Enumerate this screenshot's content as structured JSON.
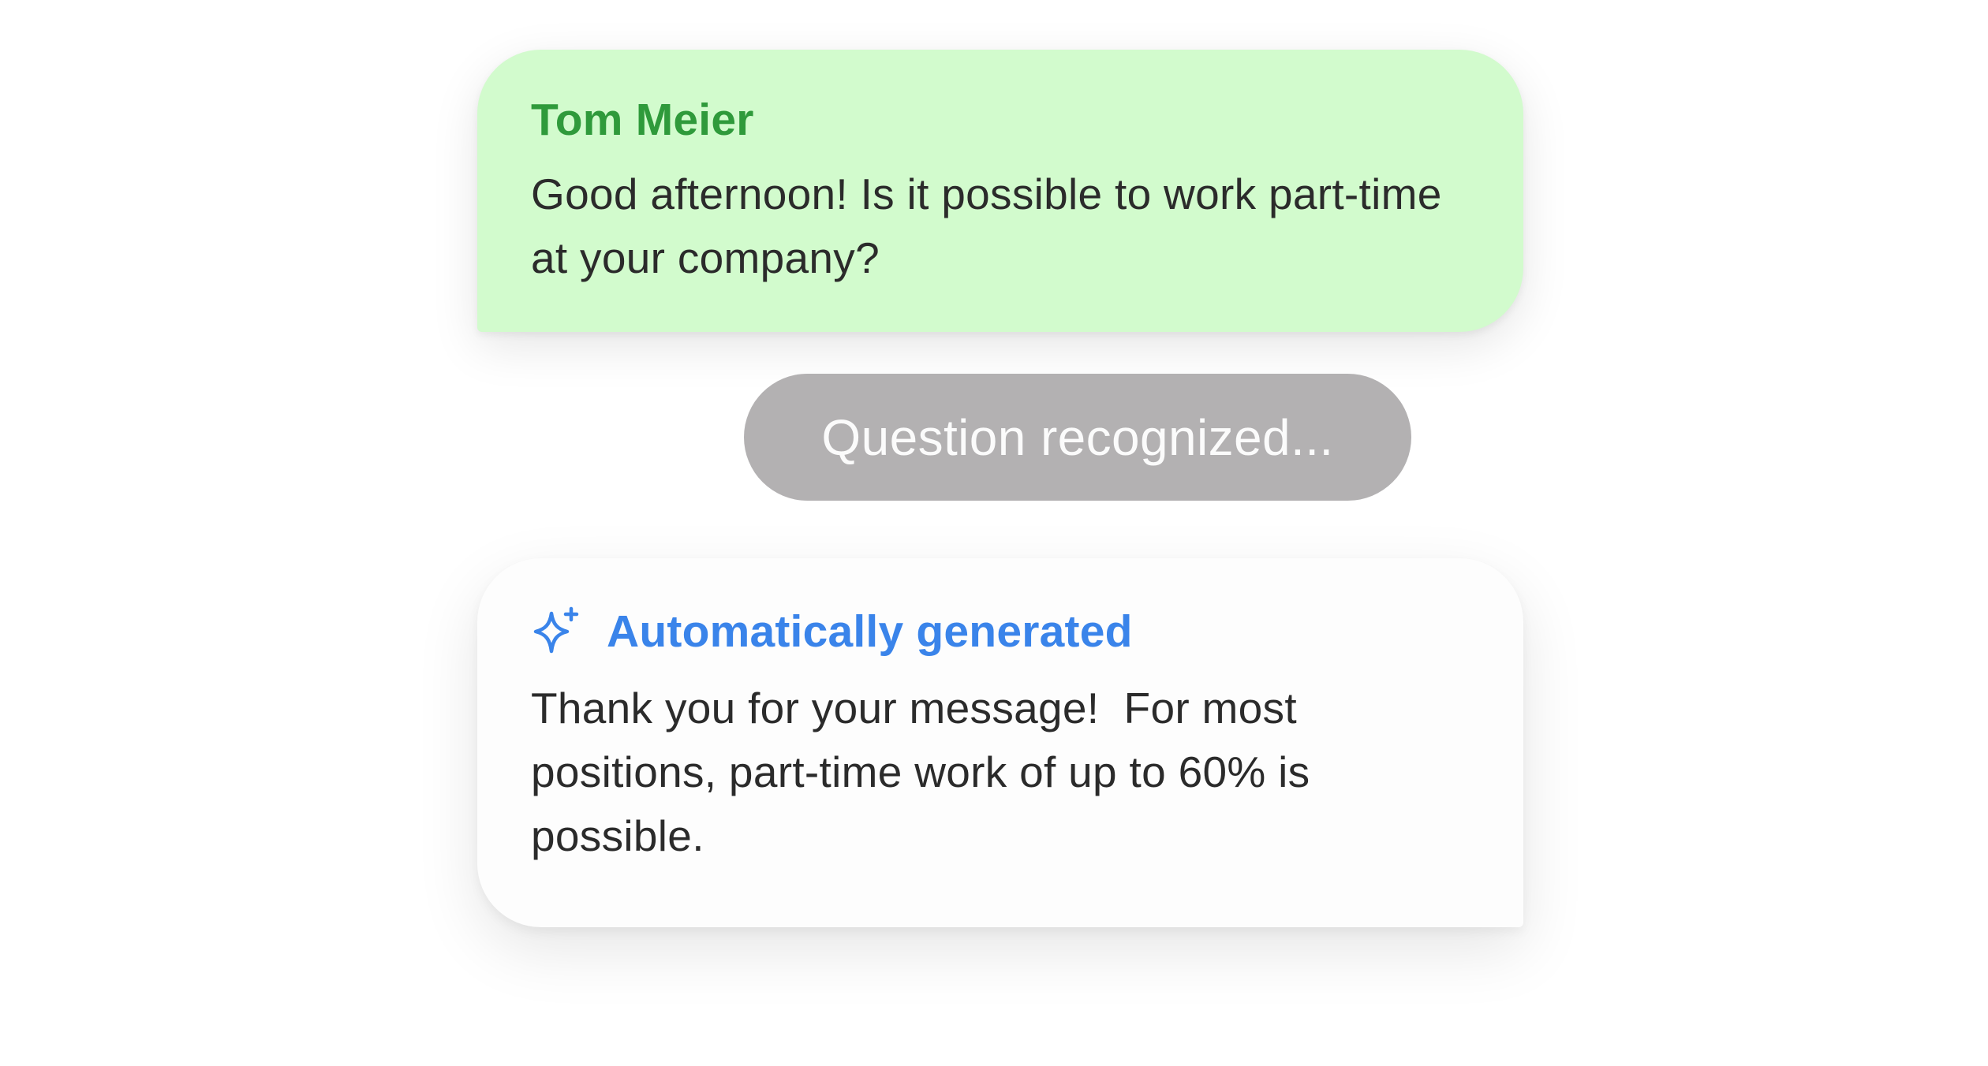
{
  "incoming_message": {
    "sender": "Tom Meier",
    "text": "Good afternoon! Is it possible to work part-time at your company?",
    "background_color": "#d2fbcd",
    "sender_color": "#2f9a3b"
  },
  "status": {
    "label": "Question recognized...",
    "background_color": "#b3b1b2"
  },
  "reply": {
    "icon": "sparkle-icon",
    "label": "Automatically generated",
    "label_color": "#3a84ea",
    "text": "Thank you for your message!  For most positions, part-time work of up to 60% is possible."
  }
}
